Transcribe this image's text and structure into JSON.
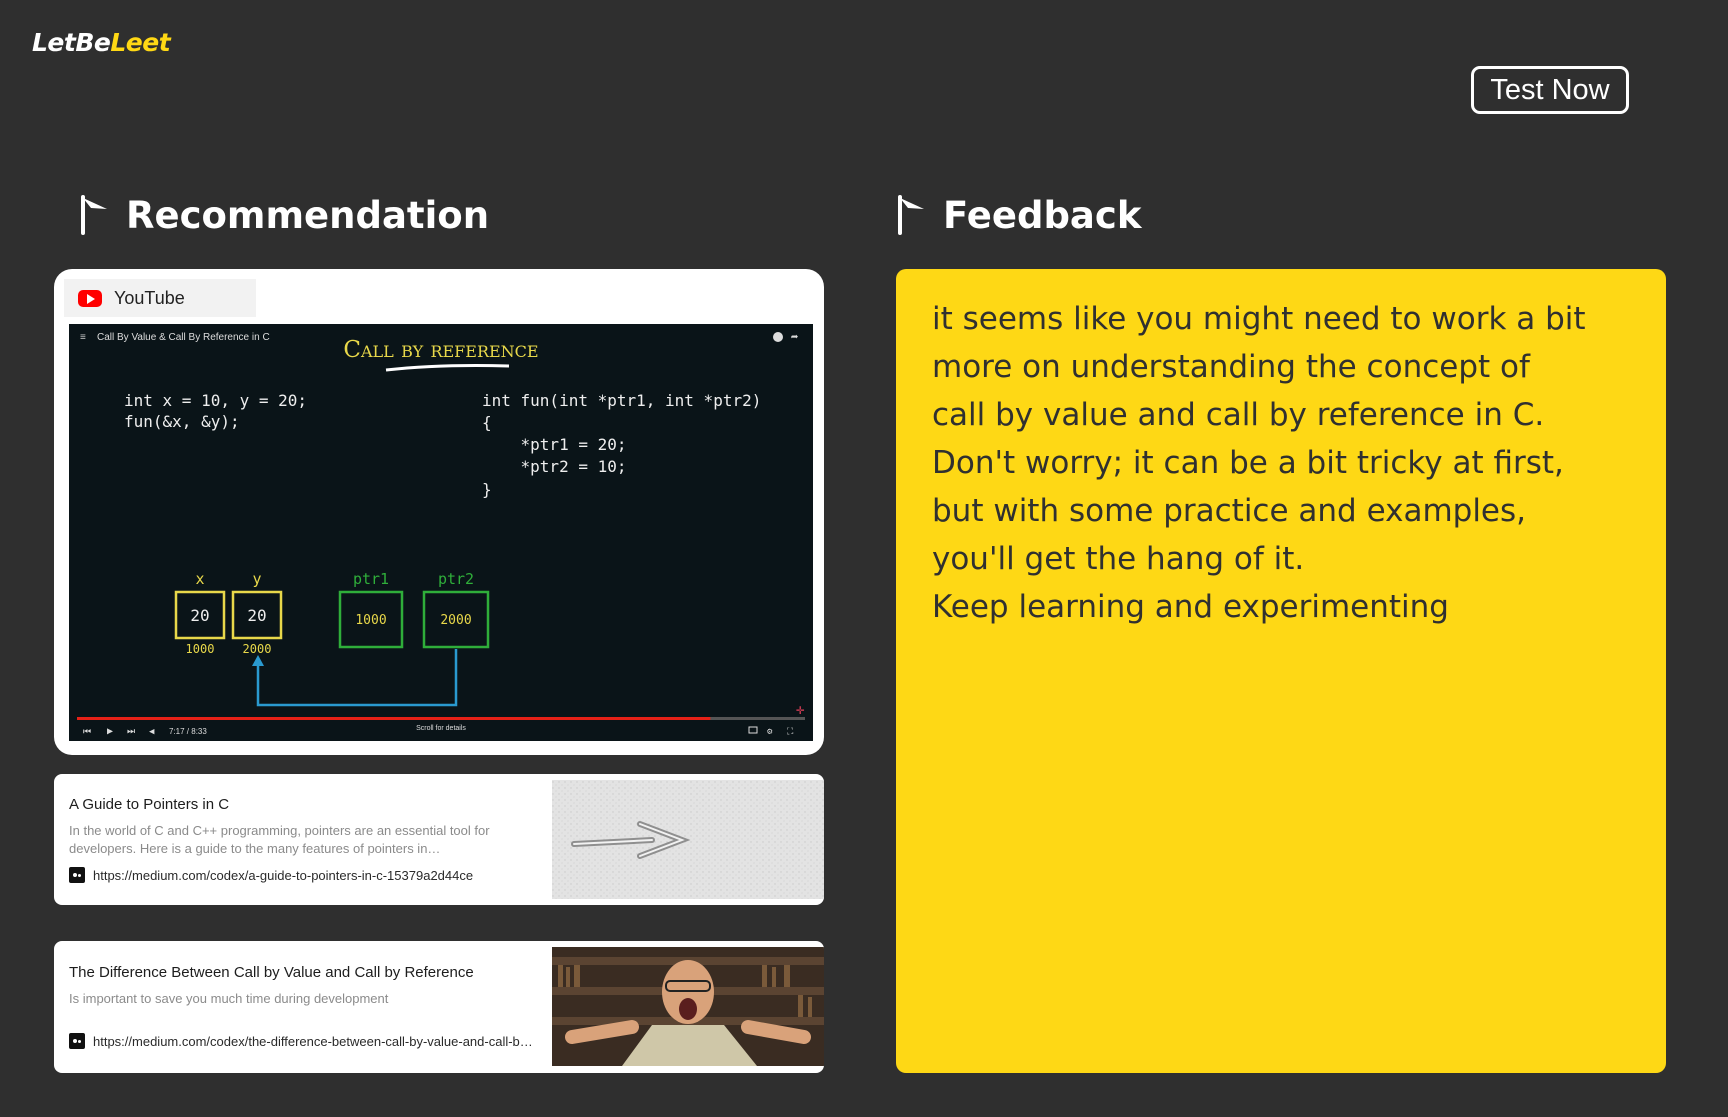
{
  "brand": {
    "logo_part1": "LetBe",
    "logo_part2": "Leet",
    "accent_color": "#ffd814"
  },
  "header": {
    "test_button": "Test Now"
  },
  "recommendation": {
    "title": "Recommendation",
    "youtube": {
      "tab_label": "YouTube",
      "video": {
        "title_bar": "Call By Value & Call By Reference in C",
        "slide_title": "Call by reference",
        "code_left": [
          "int x = 10, y = 20;",
          "fun(&x, &y);"
        ],
        "code_right": [
          "int fun(int *ptr1, int *ptr2)",
          "{",
          "    *ptr1 = 20;",
          "    *ptr2 = 10;",
          "}"
        ],
        "boxes": [
          {
            "label": "x",
            "value": "20",
            "address": "1000"
          },
          {
            "label": "y",
            "value": "20",
            "address": "2000"
          },
          {
            "label": "ptr1",
            "value": "1000"
          },
          {
            "label": "ptr2",
            "value": "2000"
          }
        ],
        "time": "7:17 / 8:33",
        "scroll_hint": "Scroll for details",
        "progress": 0.87
      }
    },
    "articles": [
      {
        "title": "A Guide to Pointers in C",
        "description": "In the world of C and C++ programming, pointers are an essential tool for developers. Here is a guide to the many features of pointers in…",
        "url": "https://medium.com/codex/a-guide-to-pointers-in-c-15379a2d44ce"
      },
      {
        "title": "The Difference Between Call by Value and Call by Reference",
        "description": "Is important to save you much time during development",
        "url": "https://medium.com/codex/the-difference-between-call-by-value-and-call-b…"
      }
    ]
  },
  "feedback": {
    "title": "Feedback",
    "background_color": "#fed815",
    "lines": [
      "it seems like you might need to work a bit",
      "more on understanding the concept of",
      "call by value and call by reference in C.",
      "Don't worry; it can be a bit tricky at first,",
      "but with some practice and examples,",
      "you'll get the hang of it.",
      "Keep learning and experimenting"
    ]
  }
}
